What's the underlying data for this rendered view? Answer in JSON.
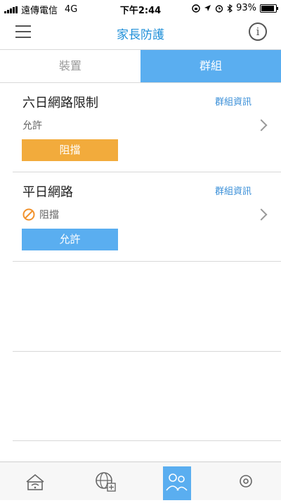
{
  "status_bar": {
    "carrier": "遠傳電信",
    "network": "4G",
    "time": "下午2:44",
    "battery": "93%"
  },
  "nav": {
    "title": "家長防護"
  },
  "tabs": [
    {
      "label": "裝置",
      "active": false
    },
    {
      "label": "群組",
      "active": true
    }
  ],
  "groups": [
    {
      "name": "六日網路限制",
      "info_label": "群組資訊",
      "status": "允許",
      "status_blocked": false,
      "action_label": "阻擋",
      "action_color": "#f2ab3c"
    },
    {
      "name": "平日網路",
      "info_label": "群組資訊",
      "status": "阻擋",
      "status_blocked": true,
      "action_label": "允許",
      "action_color": "#5aaef0"
    }
  ],
  "bottom_nav": [
    {
      "icon": "wifi-router-icon"
    },
    {
      "icon": "globe-add-icon"
    },
    {
      "icon": "family-icon",
      "active": true
    },
    {
      "icon": "settings-icon"
    }
  ]
}
